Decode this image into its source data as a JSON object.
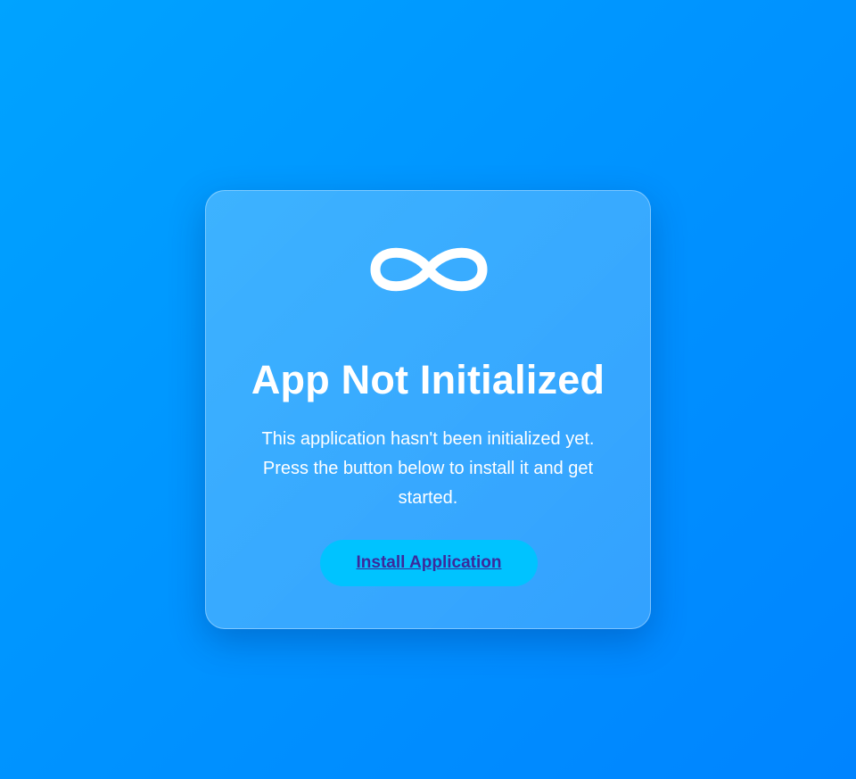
{
  "app": {
    "logo_icon": "infinity-icon",
    "title": "App Not Initialized",
    "description": "This application hasn't been initialized yet. Press the button below to install it and get started.",
    "install_button_label": "Install Application"
  },
  "colors": {
    "background_start": "#00a3ff",
    "background_end": "#0084ff",
    "button_background": "#00c3ff",
    "button_text": "#3b2a9c",
    "text": "#ffffff"
  }
}
